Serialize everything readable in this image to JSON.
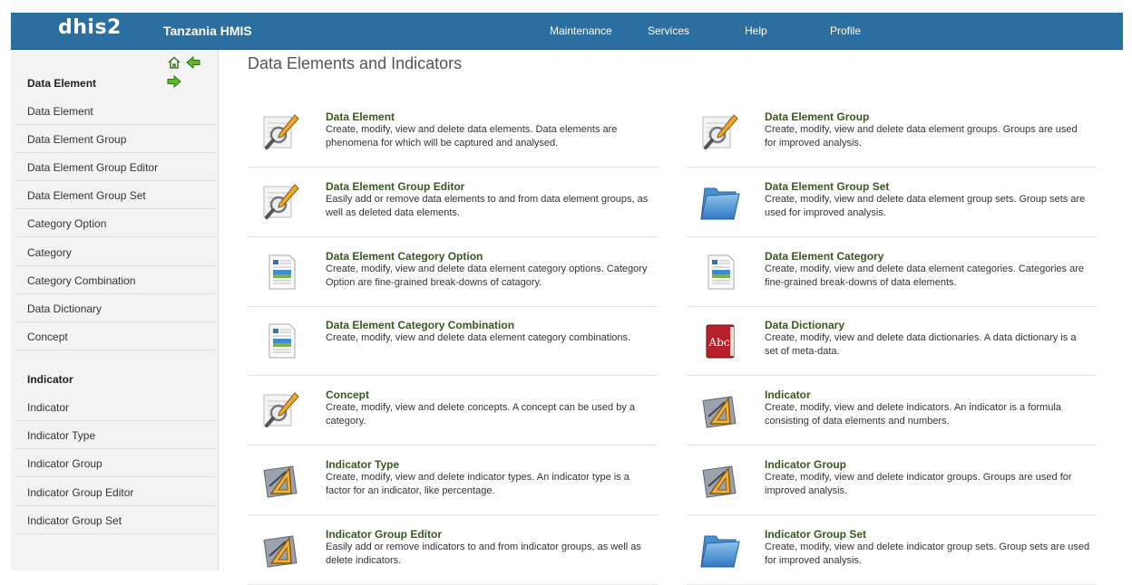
{
  "header": {
    "logo": "dhis2",
    "org": "Tanzania HMIS",
    "menu": [
      "Maintenance",
      "Services",
      "Help",
      "Profile"
    ]
  },
  "left_menu": {
    "nav_icons": [
      "home-icon",
      "arrow-left-icon",
      "arrow-right-icon"
    ],
    "sections": [
      {
        "title": "Data Element",
        "items": [
          "Data Element",
          "Data Element Group",
          "Data Element Group Editor",
          "Data Element Group Set",
          "Category Option",
          "Category",
          "Category Combination",
          "Data Dictionary",
          "Concept"
        ]
      },
      {
        "title": "Indicator",
        "items": [
          "Indicator",
          "Indicator Type",
          "Indicator Group",
          "Indicator Group Editor",
          "Indicator Group Set"
        ]
      }
    ]
  },
  "main": {
    "title": "Data Elements and Indicators",
    "cards": [
      {
        "title": "Data Element",
        "desc": "Create, modify, view and delete data elements. Data elements are phenomena for which will be captured and analysed.",
        "icon": "edit-magnifier-icon"
      },
      {
        "title": "Data Element Group",
        "desc": "Create, modify, view and delete data element groups. Groups are used for improved analysis.",
        "icon": "edit-magnifier-icon"
      },
      {
        "title": "Data Element Group Editor",
        "desc": "Easily add or remove data elements to and from data element groups, as well as deleted data elements.",
        "icon": "edit-magnifier-icon"
      },
      {
        "title": "Data Element Group Set",
        "desc": "Create, modify, view and delete data element group sets. Group sets are used for improved analysis.",
        "icon": "folder-icon"
      },
      {
        "title": "Data Element Category Option",
        "desc": "Create, modify, view and delete data element category options. Category Option are fine-grained break-downs of catagory.",
        "icon": "document-icon"
      },
      {
        "title": "Data Element Category",
        "desc": "Create, modify, view and delete data element categories. Categories are fine-grained break-downs of data elements.",
        "icon": "document-icon"
      },
      {
        "title": "Data Element Category Combination",
        "desc": "Create, modify, view and delete data element category combinations.",
        "icon": "document-icon"
      },
      {
        "title": "Data Dictionary",
        "desc": "Create, modify, view and delete data dictionaries. A data dictionary is a set of meta-data.",
        "icon": "dictionary-book-icon"
      },
      {
        "title": "Concept",
        "desc": "Create, modify, view and delete concepts. A concept can be used by a category.",
        "icon": "edit-magnifier-icon"
      },
      {
        "title": "Indicator",
        "desc": "Create, modify, view and delete indicators. An indicator is a formula consisting of data elements and numbers.",
        "icon": "drafting-triangle-icon"
      },
      {
        "title": "Indicator Type",
        "desc": "Create, modify, view and delete indicator types. An indicator type is a factor for an indicator, like percentage.",
        "icon": "drafting-triangle-icon"
      },
      {
        "title": "Indicator Group",
        "desc": "Create, modify, view and delete indicator groups. Groups are used for improved analysis.",
        "icon": "drafting-triangle-icon"
      },
      {
        "title": "Indicator Group Editor",
        "desc": "Easily add or remove indicators to and from indicator groups, as well as delete indicators.",
        "icon": "drafting-triangle-icon"
      },
      {
        "title": "Indicator Group Set",
        "desc": "Create, modify, view and delete indicator group sets. Group sets are used for improved analysis.",
        "icon": "folder-icon"
      }
    ],
    "book_icon_text": "Abc"
  },
  "colors": {
    "header": "#2b6ea0",
    "card_title": "#39581f",
    "sidebar": "#f3f3f3"
  }
}
